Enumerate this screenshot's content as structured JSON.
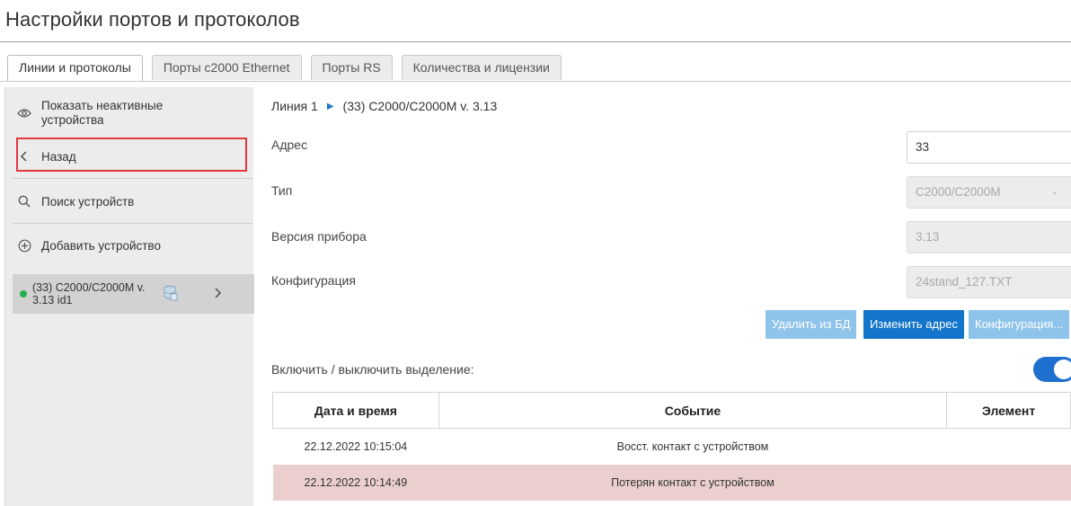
{
  "page": {
    "title": "Настройки портов и протоколов"
  },
  "tabs": [
    {
      "label": "Линии и протоколы",
      "active": true
    },
    {
      "label": "Порты с2000 Ethernet",
      "active": false
    },
    {
      "label": "Порты RS",
      "active": false
    },
    {
      "label": "Количества и лицензии",
      "active": false
    }
  ],
  "sidebar": {
    "show_inactive": {
      "icon": "eye-icon",
      "label": "Показать неактивные устройства"
    },
    "back": {
      "icon": "chevron-left-icon",
      "label": "Назад"
    },
    "search": {
      "icon": "search-icon",
      "label": "Поиск устройств"
    },
    "add": {
      "icon": "plus-circle-icon",
      "label": "Добавить устройство"
    },
    "device": {
      "status_color": "#22b14c",
      "label": "(33) С2000/С2000М v. 3.13 id1",
      "icon": "database-icon",
      "chevron": "chevron-right-icon"
    }
  },
  "breadcrumb": {
    "line": "Линия 1",
    "device": "(33) С2000/С2000М v. 3.13"
  },
  "fields": {
    "address": {
      "label": "Адрес",
      "value": "33"
    },
    "type": {
      "label": "Тип",
      "value": "С2000/С2000М"
    },
    "version": {
      "label": "Версия прибора",
      "value": "3.13"
    },
    "config": {
      "label": "Конфигурация",
      "value": "24stand_127.TXT"
    }
  },
  "buttons": {
    "delete": "Удалить из БД",
    "change_address": "Изменить адрес",
    "configuration": "Конфигурация..."
  },
  "highlight_toggle": {
    "label": "Включить / выключить выделение:",
    "on": true
  },
  "events": {
    "headers": [
      "Дата и время",
      "Событие",
      "Элемент"
    ],
    "rows": [
      {
        "datetime": "22.12.2022 10:15:04",
        "event": "Восст. контакт с устройством",
        "element": "",
        "highlight": false
      },
      {
        "datetime": "22.12.2022 10:14:49",
        "event": "Потерян контакт с устройством",
        "element": "",
        "highlight": true
      }
    ]
  },
  "colors": {
    "accent": "#1275c9",
    "accent_light": "#8ec3ea",
    "alert_row": "#ebcfcf",
    "back_highlight": "#e0393e"
  }
}
